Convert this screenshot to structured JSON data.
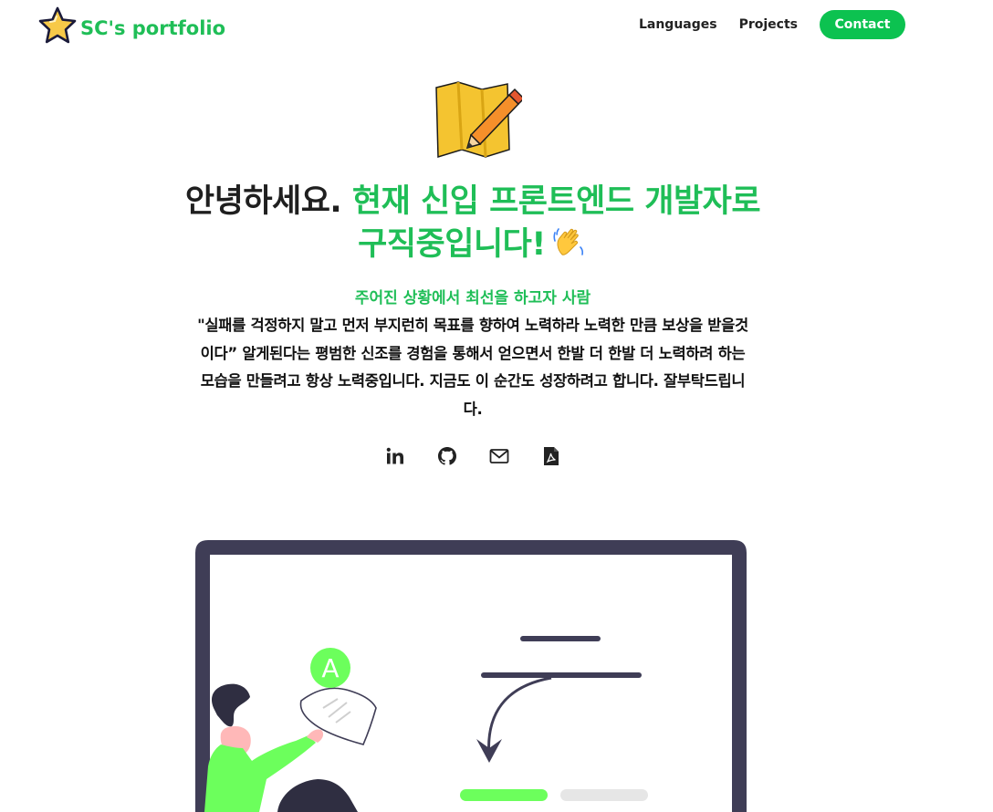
{
  "nav": {
    "brand": "SC's portfolio",
    "links": [
      "Languages",
      "Projects"
    ],
    "contact": "Contact"
  },
  "hero": {
    "headline_dark": "안녕하세요.",
    "headline_green": "현재 신입 프론트엔드 개발자로 구직중입니다!",
    "subtitle": "주어진 상황에서 최선을 하고자 사람",
    "intro": "\"실패를 걱정하지 말고 먼저 부지런히 목표를 향하여 노력하라 노력한 만큼 보상을 받을것이다” 알게된다는 평범한 신조를 경험을 통해서 얻으면서 한발 더 한발 더 노력하려 하는 모습을 만들려고 항상 노력중입니다. 지금도 이 순간도 성장하려고 합니다. 잘부탁드립니다."
  },
  "socials": [
    "linkedin-icon",
    "github-icon",
    "mail-icon",
    "pdf-icon"
  ],
  "illustration": {
    "badge_letter": "A"
  },
  "colors": {
    "brand_green": "#1fbe57",
    "button_green": "#0cc250",
    "text_dark": "#1f1f1f",
    "frame": "#3f3d56",
    "accent": "#6cff5c"
  }
}
